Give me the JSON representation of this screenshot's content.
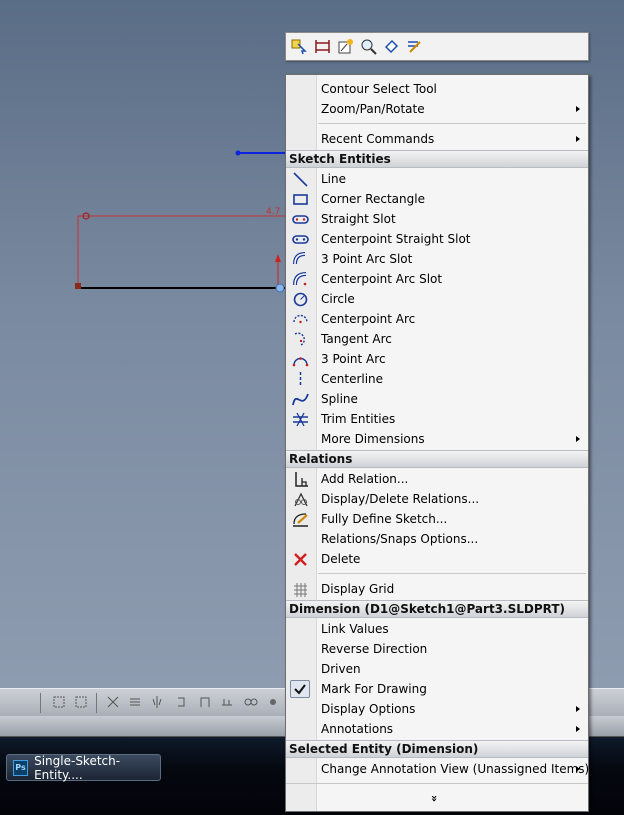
{
  "context_toolbar": {
    "icons": [
      "select-icon",
      "sketch-relations-icon",
      "smart-dimension-icon",
      "zoom-to-selection-icon",
      "normal-to-icon",
      "edit-sketch-icon"
    ]
  },
  "menu": {
    "top_items": [
      {
        "label": "Contour Select Tool",
        "submenu": false
      },
      {
        "label": "Zoom/Pan/Rotate",
        "submenu": true
      },
      {
        "label": "Recent Commands",
        "submenu": true
      }
    ],
    "sections": {
      "sketch_entities": "Sketch Entities",
      "relations": "Relations",
      "dimension": "Dimension (D1@Sketch1@Part3.SLDPRT)",
      "selected_entity": "Selected Entity (Dimension)"
    },
    "sketch_entities": [
      {
        "label": "Line",
        "icon": "line-icon"
      },
      {
        "label": "Corner Rectangle",
        "icon": "rectangle-icon"
      },
      {
        "label": "Straight Slot",
        "icon": "straight-slot-icon"
      },
      {
        "label": "Centerpoint Straight Slot",
        "icon": "centerpoint-straight-slot-icon"
      },
      {
        "label": "3 Point Arc Slot",
        "icon": "three-point-arc-slot-icon"
      },
      {
        "label": "Centerpoint Arc Slot",
        "icon": "centerpoint-arc-slot-icon"
      },
      {
        "label": "Circle",
        "icon": "circle-icon"
      },
      {
        "label": "Centerpoint Arc",
        "icon": "centerpoint-arc-icon"
      },
      {
        "label": "Tangent Arc",
        "icon": "tangent-arc-icon"
      },
      {
        "label": "3 Point Arc",
        "icon": "three-point-arc-icon"
      },
      {
        "label": "Centerline",
        "icon": "centerline-icon"
      },
      {
        "label": "Spline",
        "icon": "spline-icon"
      },
      {
        "label": "Trim Entities",
        "icon": "trim-entities-icon"
      },
      {
        "label": "More Dimensions",
        "icon": "",
        "submenu": true
      }
    ],
    "relations": [
      {
        "label": "Add Relation...",
        "icon": "add-relation-icon"
      },
      {
        "label": "Display/Delete Relations...",
        "icon": "display-delete-relations-icon"
      },
      {
        "label": "Fully Define Sketch...",
        "icon": "fully-define-sketch-icon"
      },
      {
        "label": "Relations/Snaps Options...",
        "icon": ""
      },
      {
        "label": "Delete",
        "icon": "delete-icon"
      }
    ],
    "display_grid": {
      "label": "Display Grid",
      "icon": "grid-icon"
    },
    "dimension": [
      {
        "label": "Link Values",
        "submenu": false
      },
      {
        "label": "Reverse Direction",
        "submenu": false
      },
      {
        "label": "Driven",
        "submenu": false
      },
      {
        "label": "Mark For Drawing",
        "submenu": false,
        "checked": true
      },
      {
        "label": "Display Options",
        "submenu": true
      },
      {
        "label": "Annotations",
        "submenu": true
      }
    ],
    "selected_entity": [
      {
        "label": "Change Annotation View (Unassigned Items)",
        "submenu": true
      }
    ],
    "more_glyph": "»"
  },
  "taskbar": {
    "button_label": "Single-Sketch-Entity....",
    "app_icon_text": "Ps"
  },
  "sketch": {
    "dimension_text": "4.7"
  }
}
